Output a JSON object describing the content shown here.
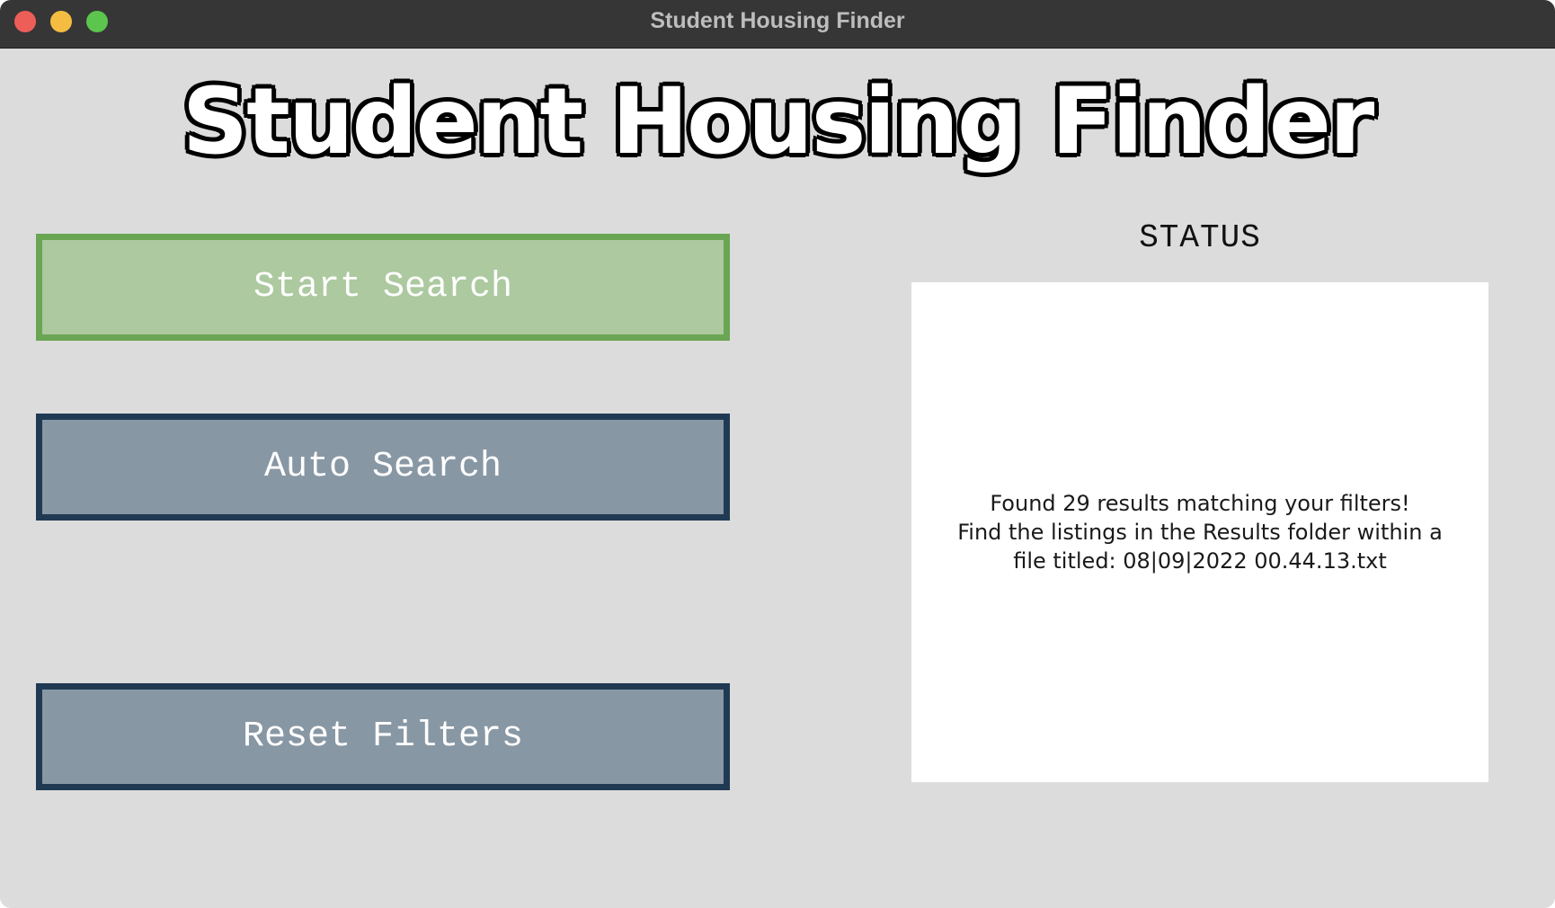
{
  "window": {
    "title": "Student Housing Finder"
  },
  "header": {
    "title": "Student Housing Finder"
  },
  "actions": {
    "start_search": "Start Search",
    "auto_search": "Auto Search",
    "reset_filters": "Reset Filters"
  },
  "status": {
    "heading": "STATUS",
    "message_lines": [
      "Found 29 results matching your filters!",
      "Find the listings in the Results folder within a",
      "file titled: 08|09|2022 00.44.13.txt"
    ]
  },
  "colors": {
    "start_fill": "#acc99f",
    "start_border": "#6aa554",
    "secondary_fill": "#8897a4",
    "secondary_border": "#203a53",
    "window_bg": "#dcdcdc",
    "titlebar_bg": "#363636"
  }
}
